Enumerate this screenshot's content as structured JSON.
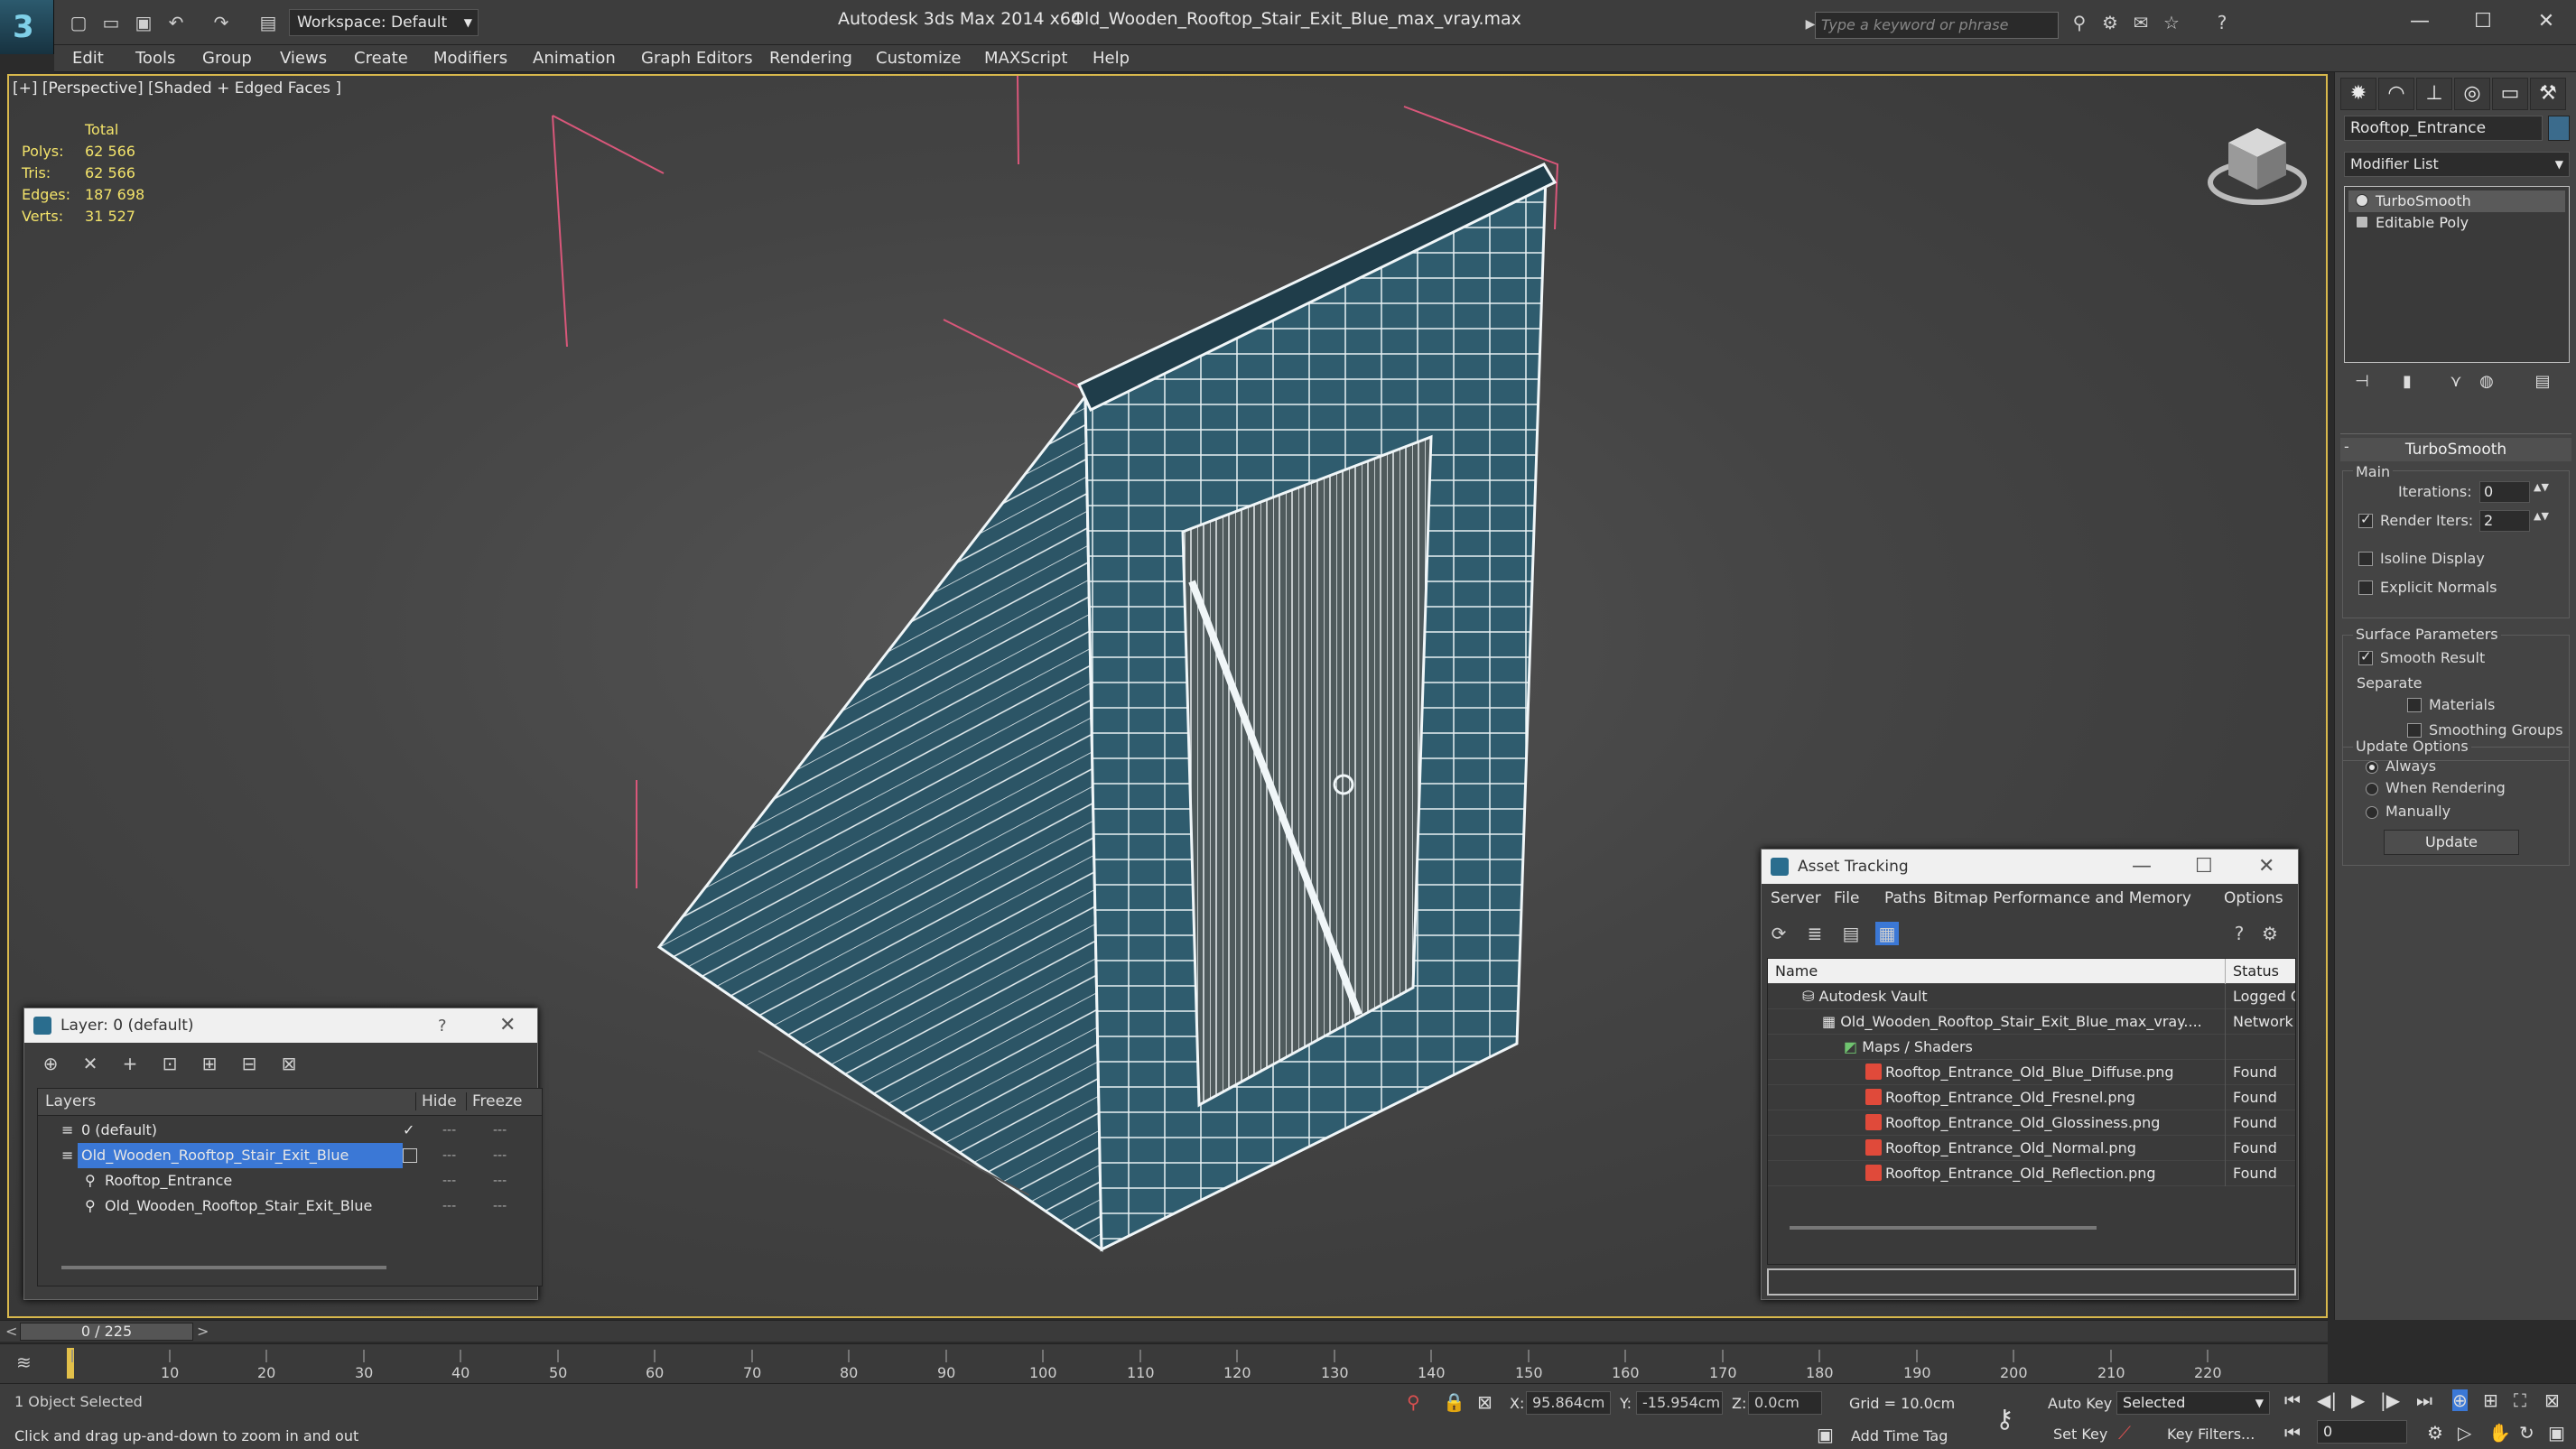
{
  "app": {
    "title": "Autodesk 3ds Max  2014 x64",
    "file": "Old_Wooden_Rooftop_Stair_Exit_Blue_max_vray.max",
    "workspace": "Workspace: Default",
    "search_placeholder": "Type a keyword or phrase"
  },
  "menu": [
    "Edit",
    "Tools",
    "Group",
    "Views",
    "Create",
    "Modifiers",
    "Animation",
    "Graph Editors",
    "Rendering",
    "Customize",
    "MAXScript",
    "Help"
  ],
  "viewport": {
    "label": "[+] [Perspective] [Shaded + Edged Faces ]",
    "stats": {
      "header": "Total",
      "rows": [
        {
          "label": "Polys:",
          "value": "62 566"
        },
        {
          "label": "Tris:",
          "value": "62 566"
        },
        {
          "label": "Edges:",
          "value": "187 698"
        },
        {
          "label": "Verts:",
          "value": "31 527"
        }
      ]
    }
  },
  "command_panel": {
    "object_name": "Rooftop_Entrance",
    "modifier_list": "Modifier List",
    "stack": [
      "TurboSmooth",
      "Editable Poly"
    ],
    "rollout_title": "TurboSmooth",
    "main_label": "Main",
    "iterations_label": "Iterations:",
    "iterations_value": "0",
    "render_iters_label": "Render Iters:",
    "render_iters_value": "2",
    "isoline": "Isoline Display",
    "explicit_normals": "Explicit Normals",
    "surface_params": "Surface Parameters",
    "smooth_result": "Smooth Result",
    "separate": "Separate",
    "materials": "Materials",
    "smoothing_groups": "Smoothing Groups",
    "update_options": "Update Options",
    "always": "Always",
    "when_rendering": "When Rendering",
    "manually": "Manually",
    "update_button": "Update"
  },
  "layer_window": {
    "title": "Layer: 0 (default)",
    "help": "?",
    "col_layers": "Layers",
    "col_hide": "Hide",
    "col_freeze": "Freeze",
    "rows": [
      {
        "name": "0 (default)",
        "indent": 0
      },
      {
        "name": "Old_Wooden_Rooftop_Stair_Exit_Blue",
        "indent": 0
      },
      {
        "name": "Rooftop_Entrance",
        "indent": 1
      },
      {
        "name": "Old_Wooden_Rooftop_Stair_Exit_Blue",
        "indent": 1
      }
    ]
  },
  "asset_window": {
    "title": "Asset Tracking",
    "menu": [
      "Server",
      "File",
      "Paths",
      "Bitmap Performance and Memory",
      "Options"
    ],
    "col_name": "Name",
    "col_status": "Status",
    "rows": [
      {
        "name": "Autodesk Vault",
        "status": "Logged O"
      },
      {
        "name": "Old_Wooden_Rooftop_Stair_Exit_Blue_max_vray....",
        "status": "Network"
      },
      {
        "name": "Maps / Shaders",
        "status": ""
      },
      {
        "name": "Rooftop_Entrance_Old_Blue_Diffuse.png",
        "status": "Found"
      },
      {
        "name": "Rooftop_Entrance_Old_Fresnel.png",
        "status": "Found"
      },
      {
        "name": "Rooftop_Entrance_Old_Glossiness.png",
        "status": "Found"
      },
      {
        "name": "Rooftop_Entrance_Old_Normal.png",
        "status": "Found"
      },
      {
        "name": "Rooftop_Entrance_Old_Reflection.png",
        "status": "Found"
      }
    ]
  },
  "timeline": {
    "frame": "0 / 225",
    "ticks": [
      "10",
      "20",
      "30",
      "40",
      "50",
      "60",
      "70",
      "80",
      "90",
      "100",
      "110",
      "120",
      "130",
      "140",
      "150",
      "160",
      "170",
      "180",
      "190",
      "200",
      "210",
      "220"
    ]
  },
  "status": {
    "selection": "1 Object Selected",
    "prompt": "Click and drag up-and-down to zoom in and out",
    "x_label": "X:",
    "x_value": "95.864cm",
    "y_label": "Y:",
    "y_value": "-15.954cm",
    "z_label": "Z:",
    "z_value": "0.0cm",
    "grid": "Grid = 10.0cm",
    "add_time_tag": "Add Time Tag",
    "auto_key": "Auto Key",
    "selected": "Selected",
    "set_key": "Set Key",
    "key_filters": "Key Filters...",
    "frame_value": "0"
  },
  "colors": {
    "selection_blue": "#3b78d6",
    "viewport_border": "#d8b84c",
    "stats_yellow": "#f3e36a",
    "bbox_pink": "#d9577a"
  }
}
